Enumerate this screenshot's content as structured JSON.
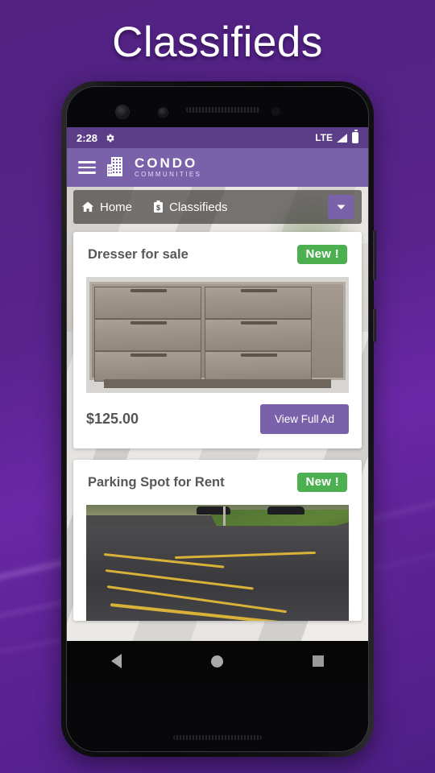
{
  "promo": {
    "title": "Classifieds",
    "bg_color": "#4e2080"
  },
  "phone": {
    "status_bar": {
      "time": "2:28",
      "settings_icon": "gear-icon",
      "network": "LTE",
      "signal_icon": "signal-icon",
      "battery_icon": "battery-icon"
    },
    "app_bar": {
      "menu_icon": "hamburger-icon",
      "logo_icon": "building-logo-icon",
      "brand_line1": "CONDO",
      "brand_line2": "COMMUNITIES",
      "color": "#7a62ab"
    },
    "breadcrumb": {
      "items": [
        {
          "label": "Home",
          "icon": "home-icon"
        },
        {
          "label": "Classifieds",
          "icon": "price-tag-icon"
        }
      ],
      "dropdown_icon": "chevron-down-icon"
    },
    "listings": [
      {
        "title": "Dresser for sale",
        "badge": "New !",
        "badge_color": "#4caf50",
        "image": "dresser-photo",
        "price": "$125.00",
        "cta": "View Full Ad"
      },
      {
        "title": "Parking Spot for Rent",
        "badge": "New !",
        "badge_color": "#4caf50",
        "image": "parking-lot-photo",
        "price": "",
        "cta": ""
      }
    ],
    "nav_bar": {
      "back": "back-icon",
      "home": "home-circle-icon",
      "recents": "recents-icon"
    }
  }
}
